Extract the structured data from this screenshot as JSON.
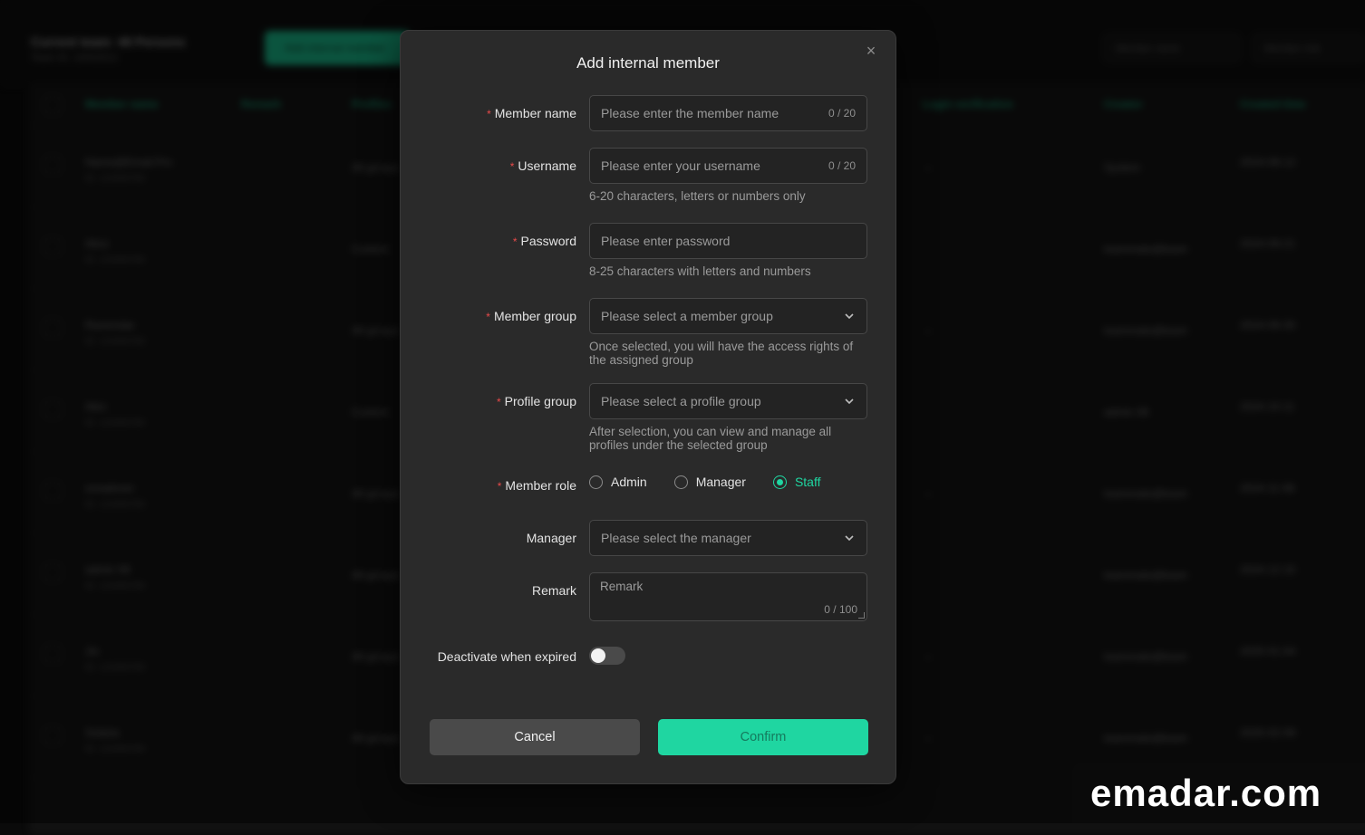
{
  "background": {
    "title": "Current team: 48 Persons",
    "subtitle": "Team ID: 10002512",
    "create_button": "Add internal member",
    "filter_search": "Member name",
    "filter_group": "Member role",
    "columns": [
      "Member name",
      "Remark",
      "Profiles",
      "Login verification",
      "Creator",
      "Created time"
    ],
    "rows": [
      {
        "name": "Name@Email.Pro",
        "sub": "ID: 123456789",
        "profiles": "All groups",
        "verify": "--",
        "creator": "System",
        "time": "2024-08-12"
      },
      {
        "name": "Alice",
        "sub": "ID: 123456789",
        "profiles": "Custom",
        "verify": "",
        "creator": "teammate@team",
        "time": "2024-09-21"
      },
      {
        "name": "Ravenstar",
        "sub": "ID: 123456789",
        "profiles": "All groups",
        "verify": "--",
        "creator": "teammate@team",
        "time": "2024-09-30"
      },
      {
        "name": "Alex",
        "sub": "ID: 123456789",
        "profiles": "Custom",
        "verify": "",
        "creator": "admin 08",
        "time": "2024-10-11"
      },
      {
        "name": "snowlover",
        "sub": "ID: 123456789",
        "profiles": "All groups",
        "verify": "--",
        "creator": "teammate@team",
        "time": "2024-11-08"
      },
      {
        "name": "admin 09",
        "sub": "ID: 123456789",
        "profiles": "All groups",
        "verify": "",
        "creator": "teammate@team",
        "time": "2024-12-15"
      },
      {
        "name": "Jin",
        "sub": "ID: 123456789",
        "profiles": "All groups",
        "verify": "--",
        "creator": "teammate@team",
        "time": "2025-01-04"
      },
      {
        "name": "Solaria",
        "sub": "ID: 123456789",
        "profiles": "All groups",
        "verify": "--",
        "creator": "teammate@team",
        "time": "2025-02-09"
      }
    ]
  },
  "modal": {
    "title": "Add internal member",
    "member_name": {
      "label": "Member name",
      "placeholder": "Please enter the member name",
      "counter": "0 / 20"
    },
    "username": {
      "label": "Username",
      "placeholder": "Please enter your username",
      "counter": "0 / 20",
      "hint": "6-20 characters, letters or numbers only"
    },
    "password": {
      "label": "Password",
      "placeholder": "Please enter password",
      "hint": "8-25 characters with letters and numbers"
    },
    "member_group": {
      "label": "Member group",
      "placeholder": "Please select a member group",
      "hint": "Once selected, you will have the access rights of the assigned group"
    },
    "profile_group": {
      "label": "Profile group",
      "placeholder": "Please select a profile group",
      "hint": "After selection, you can view and manage all profiles under the selected group"
    },
    "member_role": {
      "label": "Member role",
      "options": [
        "Admin",
        "Manager",
        "Staff"
      ],
      "selected": "Staff"
    },
    "manager": {
      "label": "Manager",
      "placeholder": "Please select the manager"
    },
    "remark": {
      "label": "Remark",
      "placeholder": "Remark",
      "counter": "0 / 100"
    },
    "deactivate": {
      "label": "Deactivate when expired",
      "enabled": false
    },
    "cancel_label": "Cancel",
    "confirm_label": "Confirm",
    "required_mark": "*"
  },
  "colors": {
    "accent": "#1fd6a1",
    "required": "#e84a4a",
    "modal_bg": "#2a2a2a"
  },
  "watermark": "emadar.com"
}
